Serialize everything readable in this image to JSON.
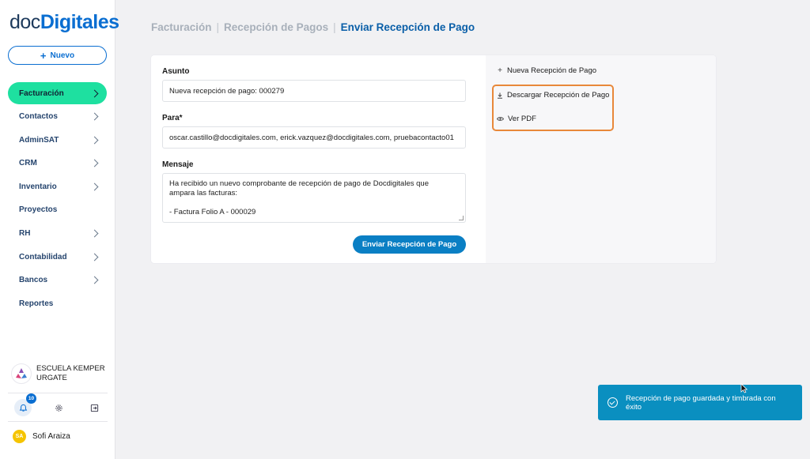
{
  "logo": {
    "part1": "doc",
    "part2": "Digitales"
  },
  "sidebar": {
    "new_button": "Nuevo",
    "items": [
      {
        "label": "Facturación",
        "active": true,
        "has_chevron": true
      },
      {
        "label": "Contactos",
        "has_chevron": true
      },
      {
        "label": "AdminSAT",
        "has_chevron": true
      },
      {
        "label": "CRM",
        "has_chevron": true
      },
      {
        "label": "Inventario",
        "has_chevron": true
      },
      {
        "label": "Proyectos",
        "has_chevron": false
      },
      {
        "label": "RH",
        "has_chevron": true
      },
      {
        "label": "Contabilidad",
        "has_chevron": true
      },
      {
        "label": "Bancos",
        "has_chevron": true
      },
      {
        "label": "Reportes",
        "has_chevron": false
      }
    ],
    "organization": {
      "line1": "ESCUELA KEMPER",
      "line2": "URGATE"
    },
    "notifications_count": "10",
    "user": {
      "initials": "SA",
      "name": "Sofi Araiza"
    }
  },
  "breadcrumb": {
    "item1": "Facturación",
    "item2": "Recepción de Pagos",
    "current": "Enviar Recepción de Pago",
    "separator": "|"
  },
  "form": {
    "subject_label": "Asunto",
    "subject_value": "Nueva recepción de pago: 000279",
    "to_label": "Para*",
    "to_value": "oscar.castillo@docdigitales.com, erick.vazquez@docdigitales.com, pruebacontacto01",
    "message_label": "Mensaje",
    "message_line1": "Ha recibido un nuevo comprobante de recepción de pago de Docdigitales que",
    "message_line2": "ampara las facturas:",
    "message_line3": "- Factura Folio A - 000029",
    "send_button": "Enviar Recepción de Pago"
  },
  "actions": {
    "new_receipt": "Nueva Recepción de Pago",
    "download_receipt": "Descargar Recepción de Pago",
    "view_pdf": "Ver PDF"
  },
  "toast": {
    "message": "Recepción de pago guardada y timbrada con éxito"
  },
  "colors": {
    "brand_blue": "#0a6ed1",
    "active_green": "#1ee0a0",
    "highlight_orange": "#e8883a",
    "toast_bg": "#0a8fc0"
  }
}
